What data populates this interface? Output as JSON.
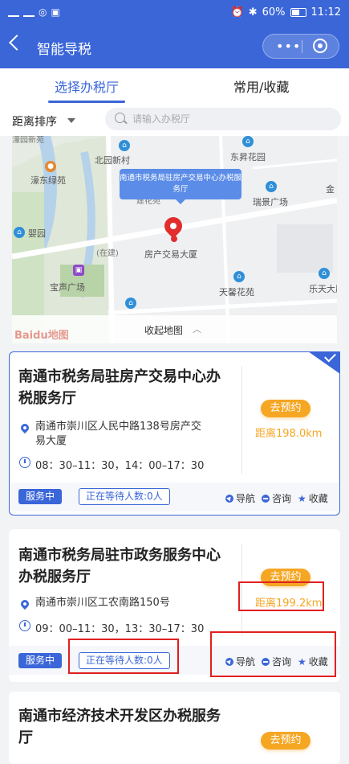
{
  "status_bar": {
    "battery": "60%",
    "time": "11:12"
  },
  "header": {
    "title": "智能导税"
  },
  "tabs": [
    {
      "label": "选择办税厅"
    },
    {
      "label": "常用/收藏"
    }
  ],
  "filter": {
    "sort_label": "距离排序",
    "search_placeholder": "请输入办税厅"
  },
  "map": {
    "bubble": "南通市税务局驻房产交易中心办税服务厅",
    "labels": {
      "l1": "北园新村",
      "l2": "东昇花园",
      "l3": "濠东绿苑",
      "l4": "瑞景广场",
      "l5": "金",
      "l6": "婴园",
      "l7": "(在建)",
      "l8": "房产交易大厦",
      "l9": "宝声广场",
      "l10": "天馨花苑",
      "l11": "乐天大厦",
      "l12": "濠园新苑",
      "l13": "建花苑"
    },
    "collapse_label": "收起地图",
    "logo": "Baidu地图"
  },
  "offices": [
    {
      "name": "南通市税务局驻房产交易中心办税服务厅",
      "address": "南通市崇川区人民中路138号房产交易大厦",
      "hours": "08：30–11：30，14：00–17：30",
      "book": "去预约",
      "distance": "距离198.0km",
      "status": "服务中",
      "waiting": "正在等待人数:0人",
      "actions": {
        "nav": "导航",
        "consult": "咨询",
        "favorite": "收藏"
      }
    },
    {
      "name": "南通市税务局驻市政务服务中心办税服务厅",
      "address": "南通市崇川区工农南路150号",
      "hours": "09：00–11：30，13：30–17：30",
      "book": "去预约",
      "distance": "距离199.2km",
      "status": "服务中",
      "waiting": "正在等待人数:0人",
      "actions": {
        "nav": "导航",
        "consult": "咨询",
        "favorite": "收藏"
      }
    },
    {
      "name": "南通市经济技术开发区办税服务厅",
      "book": "去预约"
    }
  ],
  "colors": {
    "primary": "#3a66d8",
    "accent": "#f5a623",
    "highlight": "#e02020"
  }
}
